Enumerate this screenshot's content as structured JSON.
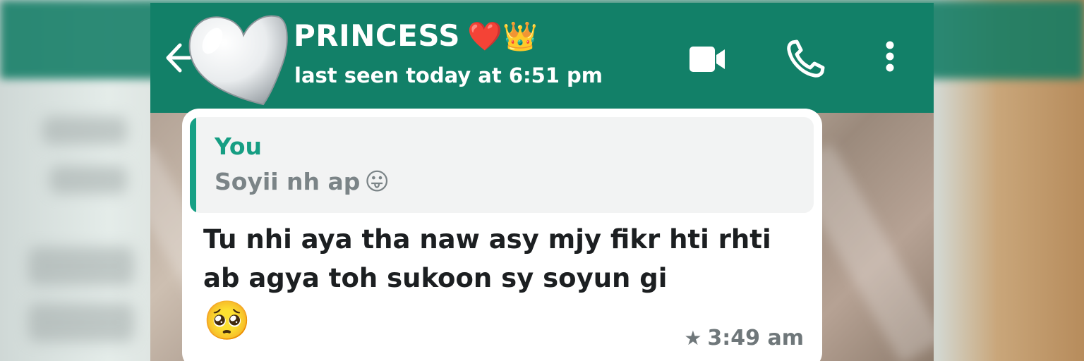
{
  "header": {
    "contact_name": "PRINCESS",
    "name_emoji": "❤️👑",
    "last_seen": "last seen today at 6:51 pm",
    "avatar_icon": "white-heart-icon",
    "back_icon": "back-arrow-icon",
    "video_icon": "video-camera-icon",
    "call_icon": "phone-icon",
    "menu_icon": "more-vertical-icon"
  },
  "message": {
    "quote": {
      "author": "You",
      "text": "Soyii nh ap",
      "emoji": "😛"
    },
    "text": "Tu nhi aya tha naw asy mjy fikr hti rhti ab agya toh sukoon sy soyun gi",
    "emoji": "🥺",
    "starred_icon": "star-icon",
    "time": "3:49 am"
  },
  "colors": {
    "header_bg": "#128068",
    "quote_accent": "#17a085",
    "bubble_bg": "#ffffff"
  }
}
